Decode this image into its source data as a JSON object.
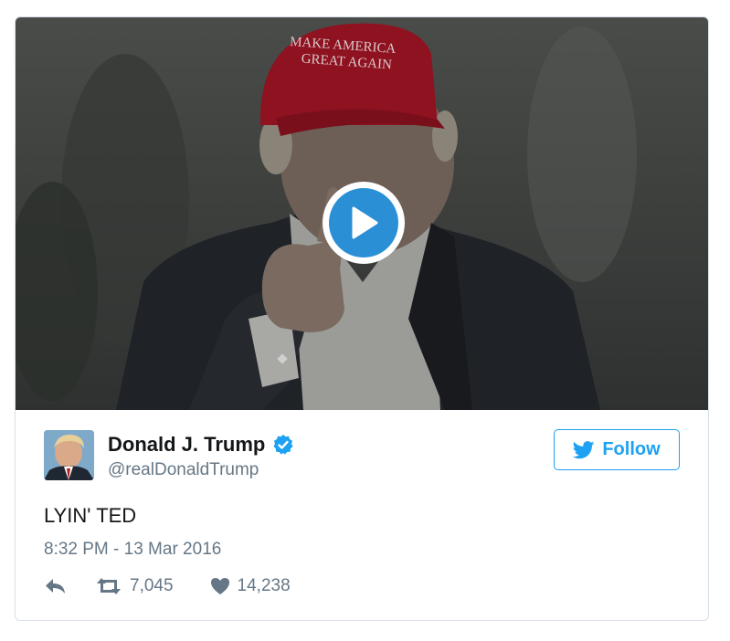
{
  "media": {
    "hat_text_line1": "MAKE AMERICA",
    "hat_text_line2": "GREAT AGAIN",
    "play_icon": "play-icon"
  },
  "author": {
    "display_name": "Donald J. Trump",
    "handle": "@realDonaldTrump",
    "verified": true
  },
  "follow_button": {
    "label": "Follow",
    "icon": "twitter-bird-icon"
  },
  "tweet": {
    "text": "LYIN' TED",
    "timestamp": "8:32 PM - 13 Mar 2016"
  },
  "actions": {
    "reply_icon": "reply-icon",
    "retweet_count": "7,045",
    "like_count": "14,238"
  },
  "colors": {
    "accent": "#1da1f2",
    "play_blue": "#2b8fd6",
    "text_primary": "#14171a",
    "text_secondary": "#657786",
    "hat_red": "#b3152a"
  }
}
